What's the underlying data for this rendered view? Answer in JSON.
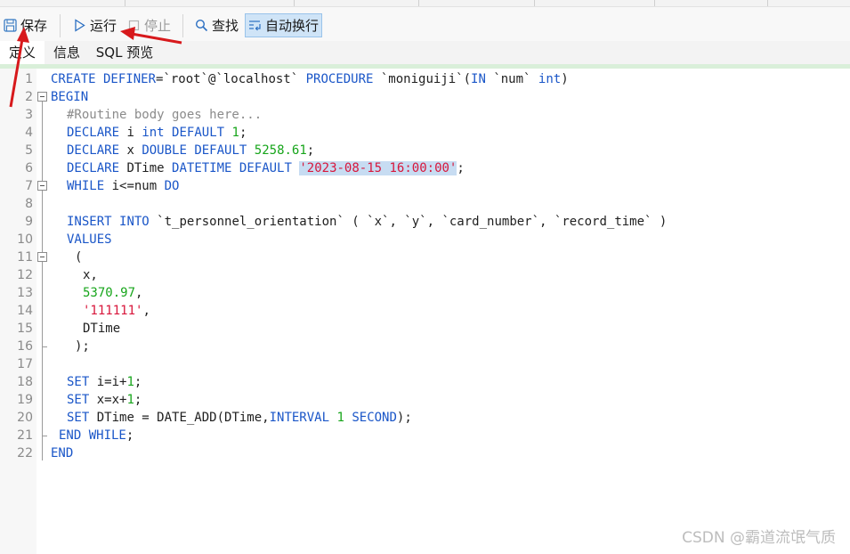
{
  "toolbar": {
    "save_label": "保存",
    "run_label": "运行",
    "stop_label": "停止",
    "find_label": "查找",
    "wrap_label": "自动换行"
  },
  "tabs": [
    {
      "label": "定义",
      "active": true
    },
    {
      "label": "信息",
      "active": false
    },
    {
      "label": "SQL 预览",
      "active": false
    }
  ],
  "code_lines": [
    "1",
    "2",
    "3",
    "4",
    "5",
    "6",
    "7",
    "8",
    "9",
    "10",
    "11",
    "12",
    "13",
    "14",
    "15",
    "16",
    "17",
    "18",
    "19",
    "20",
    "21",
    "22"
  ],
  "code": {
    "l1": {
      "kw1": "CREATE DEFINER",
      "t1": "=`root`@`localhost` ",
      "kw2": "PROCEDURE",
      "t2": " `moniguiji`(",
      "kw3": "IN",
      "t3": " `num` ",
      "kw4": "int",
      "t4": ")"
    },
    "l2": {
      "kw": "BEGIN"
    },
    "l3": {
      "comment": "#Routine body goes here..."
    },
    "l4": {
      "kw1": "DECLARE",
      "t1": " i ",
      "kw2": "int",
      "t2": " ",
      "kw3": "DEFAULT",
      "t3": " ",
      "num": "1",
      "t4": ";"
    },
    "l5": {
      "kw1": "DECLARE",
      "t1": " x ",
      "kw2": "DOUBLE",
      "t2": " ",
      "kw3": "DEFAULT",
      "t3": " ",
      "num": "5258.61",
      "t4": ";"
    },
    "l6": {
      "kw1": "DECLARE",
      "t1": " DTime ",
      "kw2": "DATETIME",
      "t2": " ",
      "kw3": "DEFAULT",
      "t3": " ",
      "str": "'2023-08-15 16:00:00'",
      "t4": ";"
    },
    "l7": {
      "kw1": "WHILE",
      "t1": " i<=num ",
      "kw2": "DO"
    },
    "l9": {
      "kw1": "INSERT",
      "t1": " ",
      "kw2": "INTO",
      "t2": " `t_personnel_orientation` ( `x`, `y`, `card_number`, `record_time` )"
    },
    "l10": {
      "kw": "VALUES"
    },
    "l11": {
      "t": "("
    },
    "l12": {
      "t": "x,"
    },
    "l13": {
      "num": "5370.97",
      "t": ","
    },
    "l14": {
      "str": "'111111'",
      "t": ","
    },
    "l15": {
      "t": "DTime"
    },
    "l16": {
      "t": ");"
    },
    "l18": {
      "kw": "SET",
      "t1": " i=i+",
      "num": "1",
      "t2": ";"
    },
    "l19": {
      "kw": "SET",
      "t1": " x=x+",
      "num": "1",
      "t2": ";"
    },
    "l20": {
      "kw": "SET",
      "t1": " DTime = DATE_ADD(DTime,",
      "kw2": "INTERVAL",
      "t2": " ",
      "num": "1",
      "t3": " ",
      "kw3": "SECOND",
      "t4": ");"
    },
    "l21": {
      "kw": "END WHILE",
      "t": ";"
    },
    "l22": {
      "kw": "END"
    }
  },
  "watermark": "CSDN @霸道流氓气质",
  "colors": {
    "keyword": "#1a56c8",
    "comment": "#8b8b8b",
    "number": "#17a51b",
    "string": "#d8173c",
    "arrow": "#d7191c",
    "active_button": "#cfe4f7"
  }
}
